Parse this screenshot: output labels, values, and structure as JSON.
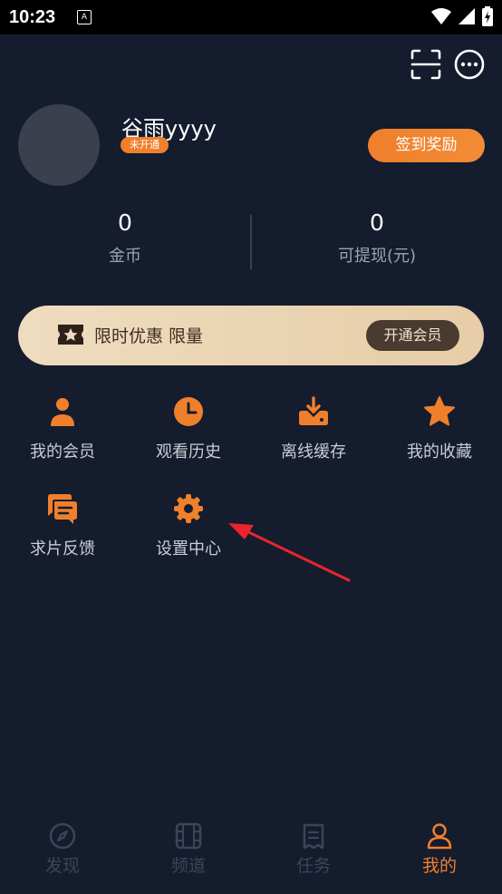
{
  "status_bar": {
    "time": "10:23",
    "a_icon": "A"
  },
  "header": {
    "scan_icon": "scan-icon",
    "more_icon": "more-icon"
  },
  "profile": {
    "username": "谷雨yyyy",
    "vip_badge": "未开通",
    "signin_button": "签到奖励"
  },
  "stats": [
    {
      "value": "0",
      "label": "金币"
    },
    {
      "value": "0",
      "label": "可提现(元)"
    }
  ],
  "promo": {
    "text": "限时优惠 限量",
    "button": "开通会员"
  },
  "menu": [
    {
      "label": "我的会员",
      "icon": "user-icon"
    },
    {
      "label": "观看历史",
      "icon": "clock-icon"
    },
    {
      "label": "离线缓存",
      "icon": "download-icon"
    },
    {
      "label": "我的收藏",
      "icon": "star-icon"
    },
    {
      "label": "求片反馈",
      "icon": "chat-icon"
    },
    {
      "label": "设置中心",
      "icon": "gear-icon"
    }
  ],
  "tabs": [
    {
      "label": "发现",
      "icon": "compass-icon",
      "active": false
    },
    {
      "label": "频道",
      "icon": "film-icon",
      "active": false
    },
    {
      "label": "任务",
      "icon": "task-icon",
      "active": false
    },
    {
      "label": "我的",
      "icon": "person-icon",
      "active": true
    }
  ],
  "colors": {
    "accent": "#f07f2c",
    "background": "#141c2e",
    "inactive_tab": "#3d4458",
    "arrow": "#e8262b"
  }
}
